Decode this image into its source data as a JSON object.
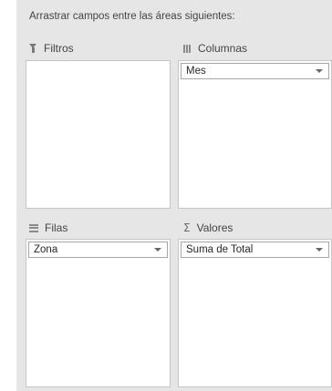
{
  "instruction": "Arrastrar campos entre las áreas siguientes:",
  "areas": {
    "filters": {
      "label": "Filtros",
      "icon": "filter-icon",
      "fields": []
    },
    "columns": {
      "label": "Columnas",
      "icon": "columns-icon",
      "fields": [
        "Mes"
      ]
    },
    "rows": {
      "label": "Filas",
      "icon": "rows-icon",
      "fields": [
        "Zona"
      ]
    },
    "values": {
      "label": "Valores",
      "icon": "sigma-icon",
      "symbol": "Σ",
      "fields": [
        "Suma de Total"
      ]
    }
  }
}
